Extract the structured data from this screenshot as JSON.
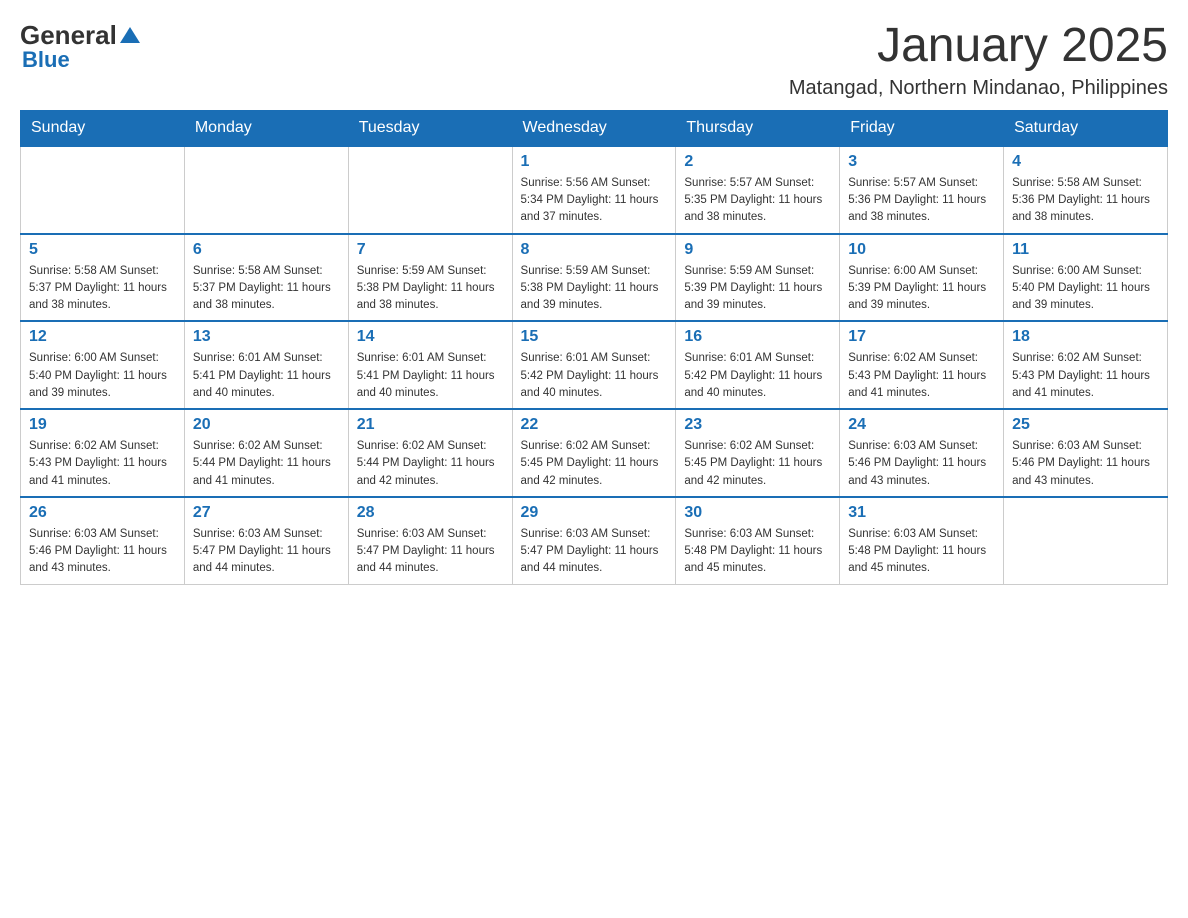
{
  "header": {
    "logo_general": "General",
    "logo_blue": "Blue",
    "month_title": "January 2025",
    "location": "Matangad, Northern Mindanao, Philippines"
  },
  "days_of_week": [
    "Sunday",
    "Monday",
    "Tuesday",
    "Wednesday",
    "Thursday",
    "Friday",
    "Saturday"
  ],
  "weeks": [
    {
      "days": [
        {
          "number": "",
          "info": ""
        },
        {
          "number": "",
          "info": ""
        },
        {
          "number": "",
          "info": ""
        },
        {
          "number": "1",
          "info": "Sunrise: 5:56 AM\nSunset: 5:34 PM\nDaylight: 11 hours and 37 minutes."
        },
        {
          "number": "2",
          "info": "Sunrise: 5:57 AM\nSunset: 5:35 PM\nDaylight: 11 hours and 38 minutes."
        },
        {
          "number": "3",
          "info": "Sunrise: 5:57 AM\nSunset: 5:36 PM\nDaylight: 11 hours and 38 minutes."
        },
        {
          "number": "4",
          "info": "Sunrise: 5:58 AM\nSunset: 5:36 PM\nDaylight: 11 hours and 38 minutes."
        }
      ]
    },
    {
      "days": [
        {
          "number": "5",
          "info": "Sunrise: 5:58 AM\nSunset: 5:37 PM\nDaylight: 11 hours and 38 minutes."
        },
        {
          "number": "6",
          "info": "Sunrise: 5:58 AM\nSunset: 5:37 PM\nDaylight: 11 hours and 38 minutes."
        },
        {
          "number": "7",
          "info": "Sunrise: 5:59 AM\nSunset: 5:38 PM\nDaylight: 11 hours and 38 minutes."
        },
        {
          "number": "8",
          "info": "Sunrise: 5:59 AM\nSunset: 5:38 PM\nDaylight: 11 hours and 39 minutes."
        },
        {
          "number": "9",
          "info": "Sunrise: 5:59 AM\nSunset: 5:39 PM\nDaylight: 11 hours and 39 minutes."
        },
        {
          "number": "10",
          "info": "Sunrise: 6:00 AM\nSunset: 5:39 PM\nDaylight: 11 hours and 39 minutes."
        },
        {
          "number": "11",
          "info": "Sunrise: 6:00 AM\nSunset: 5:40 PM\nDaylight: 11 hours and 39 minutes."
        }
      ]
    },
    {
      "days": [
        {
          "number": "12",
          "info": "Sunrise: 6:00 AM\nSunset: 5:40 PM\nDaylight: 11 hours and 39 minutes."
        },
        {
          "number": "13",
          "info": "Sunrise: 6:01 AM\nSunset: 5:41 PM\nDaylight: 11 hours and 40 minutes."
        },
        {
          "number": "14",
          "info": "Sunrise: 6:01 AM\nSunset: 5:41 PM\nDaylight: 11 hours and 40 minutes."
        },
        {
          "number": "15",
          "info": "Sunrise: 6:01 AM\nSunset: 5:42 PM\nDaylight: 11 hours and 40 minutes."
        },
        {
          "number": "16",
          "info": "Sunrise: 6:01 AM\nSunset: 5:42 PM\nDaylight: 11 hours and 40 minutes."
        },
        {
          "number": "17",
          "info": "Sunrise: 6:02 AM\nSunset: 5:43 PM\nDaylight: 11 hours and 41 minutes."
        },
        {
          "number": "18",
          "info": "Sunrise: 6:02 AM\nSunset: 5:43 PM\nDaylight: 11 hours and 41 minutes."
        }
      ]
    },
    {
      "days": [
        {
          "number": "19",
          "info": "Sunrise: 6:02 AM\nSunset: 5:43 PM\nDaylight: 11 hours and 41 minutes."
        },
        {
          "number": "20",
          "info": "Sunrise: 6:02 AM\nSunset: 5:44 PM\nDaylight: 11 hours and 41 minutes."
        },
        {
          "number": "21",
          "info": "Sunrise: 6:02 AM\nSunset: 5:44 PM\nDaylight: 11 hours and 42 minutes."
        },
        {
          "number": "22",
          "info": "Sunrise: 6:02 AM\nSunset: 5:45 PM\nDaylight: 11 hours and 42 minutes."
        },
        {
          "number": "23",
          "info": "Sunrise: 6:02 AM\nSunset: 5:45 PM\nDaylight: 11 hours and 42 minutes."
        },
        {
          "number": "24",
          "info": "Sunrise: 6:03 AM\nSunset: 5:46 PM\nDaylight: 11 hours and 43 minutes."
        },
        {
          "number": "25",
          "info": "Sunrise: 6:03 AM\nSunset: 5:46 PM\nDaylight: 11 hours and 43 minutes."
        }
      ]
    },
    {
      "days": [
        {
          "number": "26",
          "info": "Sunrise: 6:03 AM\nSunset: 5:46 PM\nDaylight: 11 hours and 43 minutes."
        },
        {
          "number": "27",
          "info": "Sunrise: 6:03 AM\nSunset: 5:47 PM\nDaylight: 11 hours and 44 minutes."
        },
        {
          "number": "28",
          "info": "Sunrise: 6:03 AM\nSunset: 5:47 PM\nDaylight: 11 hours and 44 minutes."
        },
        {
          "number": "29",
          "info": "Sunrise: 6:03 AM\nSunset: 5:47 PM\nDaylight: 11 hours and 44 minutes."
        },
        {
          "number": "30",
          "info": "Sunrise: 6:03 AM\nSunset: 5:48 PM\nDaylight: 11 hours and 45 minutes."
        },
        {
          "number": "31",
          "info": "Sunrise: 6:03 AM\nSunset: 5:48 PM\nDaylight: 11 hours and 45 minutes."
        },
        {
          "number": "",
          "info": ""
        }
      ]
    }
  ]
}
